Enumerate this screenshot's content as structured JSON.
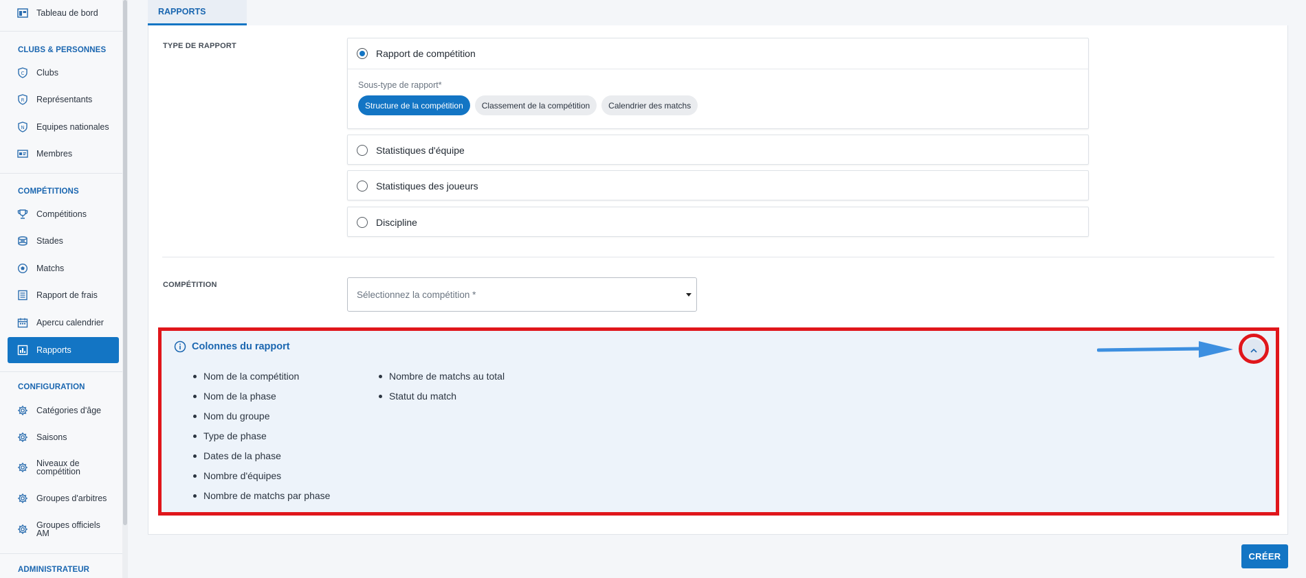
{
  "sidebar": {
    "top_item": {
      "label": "Tableau de bord",
      "icon": "dashboard-icon"
    },
    "sections": {
      "clubs": {
        "title": "CLUBS & PERSONNES",
        "items": [
          {
            "label": "Clubs",
            "icon": "club-shield-icon"
          },
          {
            "label": "Représentants",
            "icon": "representative-shield-icon"
          },
          {
            "label": "Equipes nationales",
            "icon": "national-team-shield-icon"
          },
          {
            "label": "Membres",
            "icon": "id-card-icon"
          }
        ]
      },
      "competitions": {
        "title": "COMPÉTITIONS",
        "items": [
          {
            "label": "Compétitions",
            "icon": "trophy-icon"
          },
          {
            "label": "Stades",
            "icon": "stadium-icon"
          },
          {
            "label": "Matchs",
            "icon": "ball-icon"
          },
          {
            "label": "Rapport de frais",
            "icon": "list-icon"
          },
          {
            "label": "Apercu calendrier",
            "icon": "calendar-icon"
          },
          {
            "label": "Rapports",
            "icon": "bar-chart-icon",
            "active": true
          }
        ]
      },
      "configuration": {
        "title": "CONFIGURATION",
        "items": [
          {
            "label": "Catégories d'âge",
            "icon": "gear-icon"
          },
          {
            "label": "Saisons",
            "icon": "gear-icon"
          },
          {
            "label": "Niveaux de compétition",
            "icon": "gear-icon"
          },
          {
            "label": "Groupes d'arbitres",
            "icon": "gear-icon"
          },
          {
            "label": "Groupes officiels AM",
            "icon": "gear-icon"
          }
        ]
      },
      "admin": {
        "title": "ADMINISTRATEUR"
      }
    }
  },
  "tab": {
    "label": "RAPPORTS"
  },
  "report_type": {
    "label": "TYPE DE RAPPORT",
    "options": [
      {
        "label": "Rapport de compétition",
        "selected": true
      },
      {
        "label": "Statistiques d'équipe",
        "selected": false
      },
      {
        "label": "Statistiques des joueurs",
        "selected": false
      },
      {
        "label": "Discipline",
        "selected": false
      }
    ],
    "subtype": {
      "label": "Sous-type de rapport*",
      "chips": [
        {
          "label": "Structure de la compétition",
          "active": true
        },
        {
          "label": "Classement de la compétition",
          "active": false
        },
        {
          "label": "Calendrier des matchs",
          "active": false
        }
      ]
    }
  },
  "competition": {
    "label": "COMPÉTITION",
    "placeholder": "Sélectionnez la compétition *"
  },
  "columns_panel": {
    "title": "Colonnes du rapport",
    "col1": [
      "Nom de la compétition",
      "Nom de la phase",
      "Nom du groupe",
      "Type de phase",
      "Dates de la phase",
      "Nombre d'équipes",
      "Nombre de matchs par phase"
    ],
    "col2": [
      "Nombre de matchs au total",
      "Statut du match"
    ]
  },
  "actions": {
    "create_label": "CRÉER"
  },
  "colors": {
    "accent": "#1375c4",
    "annotation": "#e0161b",
    "arrow": "#3d8fe0",
    "panel_bg": "#edf3fa"
  }
}
